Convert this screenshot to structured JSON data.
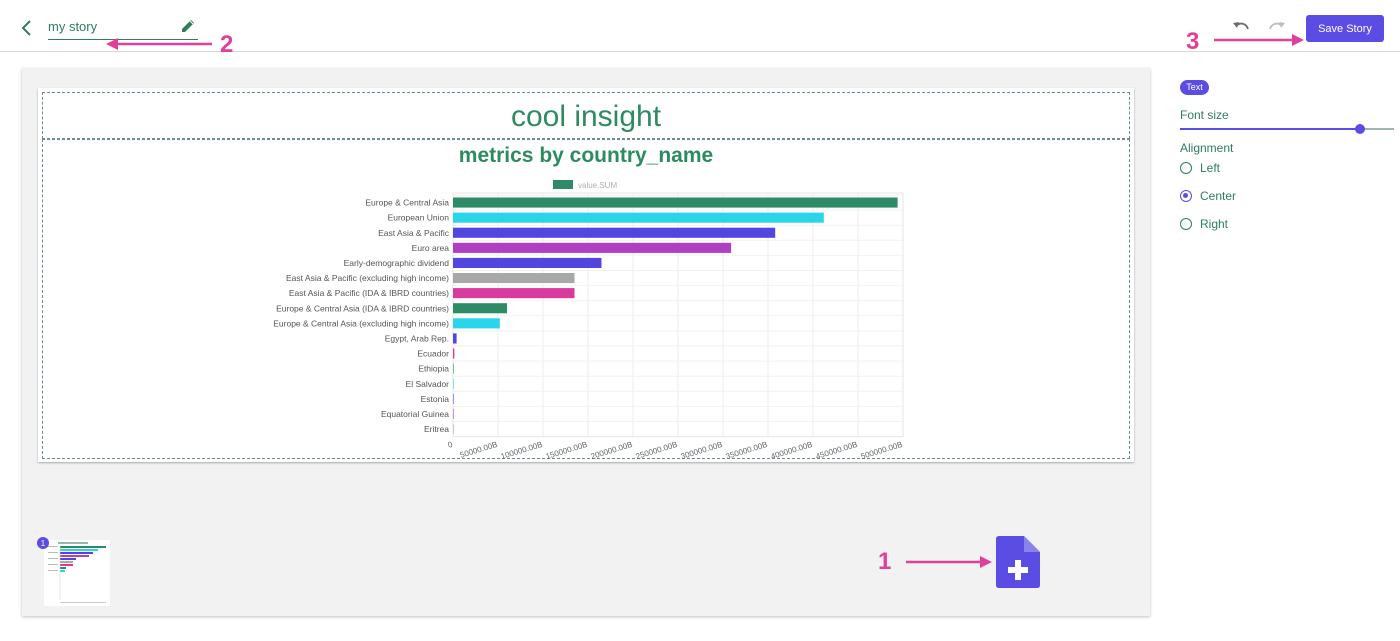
{
  "header": {
    "story_title": "my story",
    "save_label": "Save Story"
  },
  "annotations": [
    "1",
    "2",
    "3"
  ],
  "slide": {
    "heading": "cool insight"
  },
  "chart_data": {
    "type": "bar",
    "orientation": "horizontal",
    "title": "metrics by country_name",
    "legend": "value.SUM",
    "categories": [
      "Europe & Central Asia",
      "European Union",
      "East Asia & Pacific",
      "Euro area",
      "Early-demographic dividend",
      "East Asia & Pacific (excluding high income)",
      "East Asia & Pacific (IDA & IBRD countries)",
      "Europe & Central Asia (IDA & IBRD countries)",
      "Europe & Central Asia (excluding high income)",
      "Egypt, Arab Rep.",
      "Ecuador",
      "Ethiopia",
      "El Salvador",
      "Estonia",
      "Equatorial Guinea",
      "Eritrea"
    ],
    "values": [
      494000,
      412000,
      358000,
      309000,
      165000,
      135000,
      135000,
      60000,
      52000,
      4000,
      1500,
      300,
      200,
      150,
      100,
      80
    ],
    "bar_colors": [
      "#2e8b68",
      "#2ad4ea",
      "#5245e0",
      "#b13fc3",
      "#5245e0",
      "#a8a8a8",
      "#d83a9e",
      "#2e8b68",
      "#2ad4ea",
      "#5245e0",
      "#d83a9e",
      "#2e8b68",
      "#2ad4ea",
      "#5245e0",
      "#b13fc3",
      "#a8a8a8"
    ],
    "xlim": [
      0,
      500000
    ],
    "xticks": [
      "0",
      "50000.00B",
      "100000.00B",
      "150000.00B",
      "200000.00B",
      "250000.00B",
      "300000.00B",
      "350000.00B",
      "400000.00B",
      "450000.00B",
      "500000.00B"
    ],
    "grid": true
  },
  "sidebar": {
    "chip": "Text",
    "font_size_label": "Font size",
    "font_size_level": 0.84,
    "alignment_label": "Alignment",
    "alignment_options": [
      "Left",
      "Center",
      "Right"
    ],
    "alignment_selected": "Center"
  },
  "thumbnail": {
    "page_number": "1"
  },
  "colors": {
    "accent": "#5b4de3",
    "brand_green": "#2e8b60",
    "annotation": "#e0409a"
  }
}
